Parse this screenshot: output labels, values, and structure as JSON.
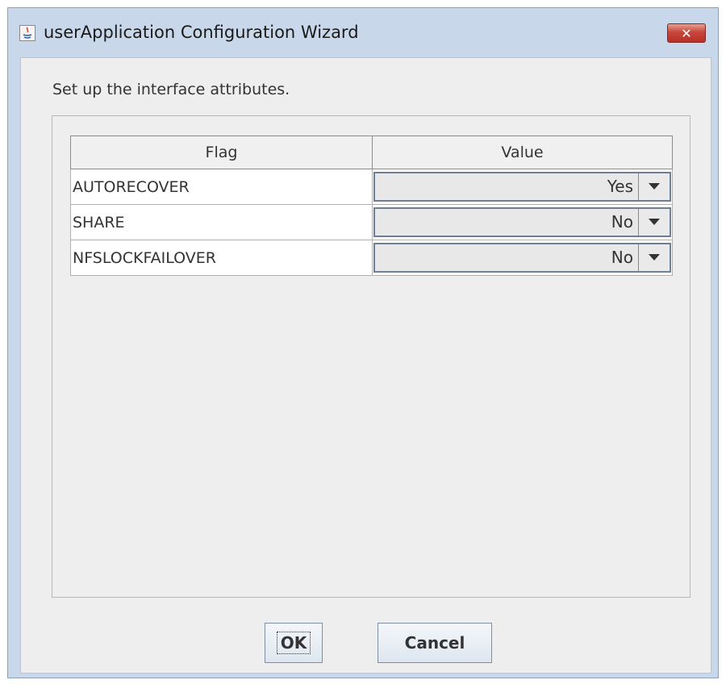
{
  "window": {
    "title": "userApplication Configuration Wizard",
    "app_icon": "java-icon",
    "close_symbol": "✕"
  },
  "instruction": "Set up the interface attributes.",
  "table": {
    "headers": [
      "Flag",
      "Value"
    ],
    "rows": [
      {
        "flag": "AUTORECOVER",
        "value": "Yes"
      },
      {
        "flag": "SHARE",
        "value": "No"
      },
      {
        "flag": "NFSLOCKFAILOVER",
        "value": "No"
      }
    ]
  },
  "buttons": {
    "ok": "OK",
    "cancel": "Cancel"
  },
  "colors": {
    "title_bar": "#c8d8ea",
    "close_button": "#c6463a",
    "client_bg": "#eeeeee"
  }
}
